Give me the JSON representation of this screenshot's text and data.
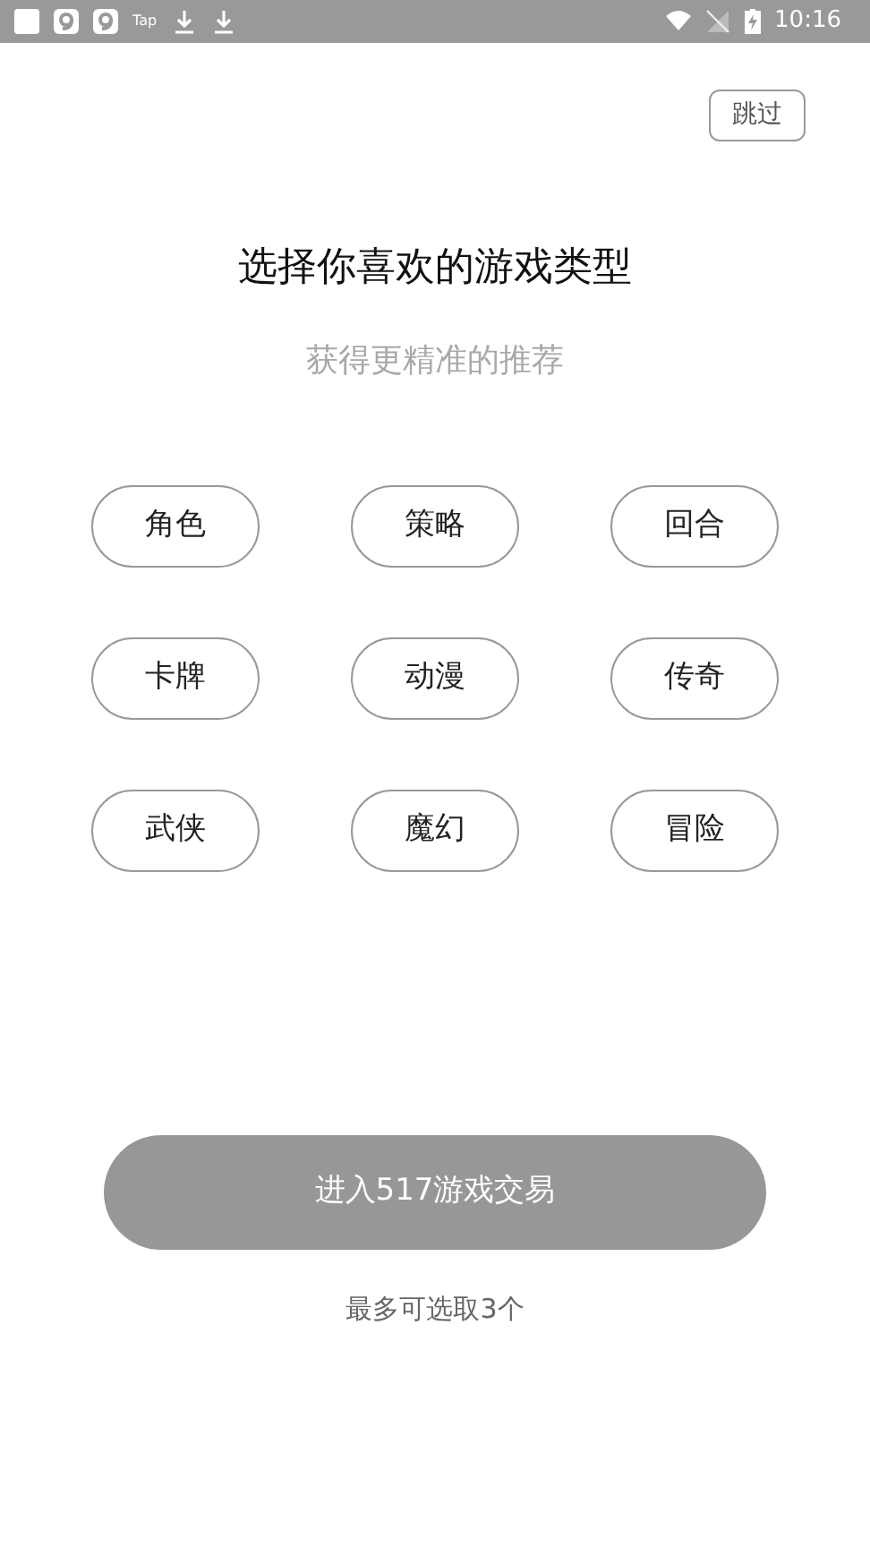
{
  "status_bar": {
    "notifications": [
      {
        "kind": "square"
      },
      {
        "kind": "nine"
      },
      {
        "kind": "nine"
      },
      {
        "kind": "text",
        "text": "Tap"
      },
      {
        "kind": "download"
      },
      {
        "kind": "download"
      }
    ],
    "time": "10:16"
  },
  "skip_button": {
    "label": "跳过"
  },
  "title": "选择你喜欢的游戏类型",
  "subtitle": "获得更精准的推荐",
  "tags": [
    {
      "label": "角色",
      "selected": false
    },
    {
      "label": "策略",
      "selected": false
    },
    {
      "label": "回合",
      "selected": false
    },
    {
      "label": "卡牌",
      "selected": false
    },
    {
      "label": "动漫",
      "selected": false
    },
    {
      "label": "传奇",
      "selected": false
    },
    {
      "label": "武侠",
      "selected": false
    },
    {
      "label": "魔幻",
      "selected": false
    },
    {
      "label": "冒险",
      "selected": false
    }
  ],
  "enter_button": {
    "label": "进入517游戏交易",
    "disabled": true
  },
  "hint": "最多可选取3个"
}
